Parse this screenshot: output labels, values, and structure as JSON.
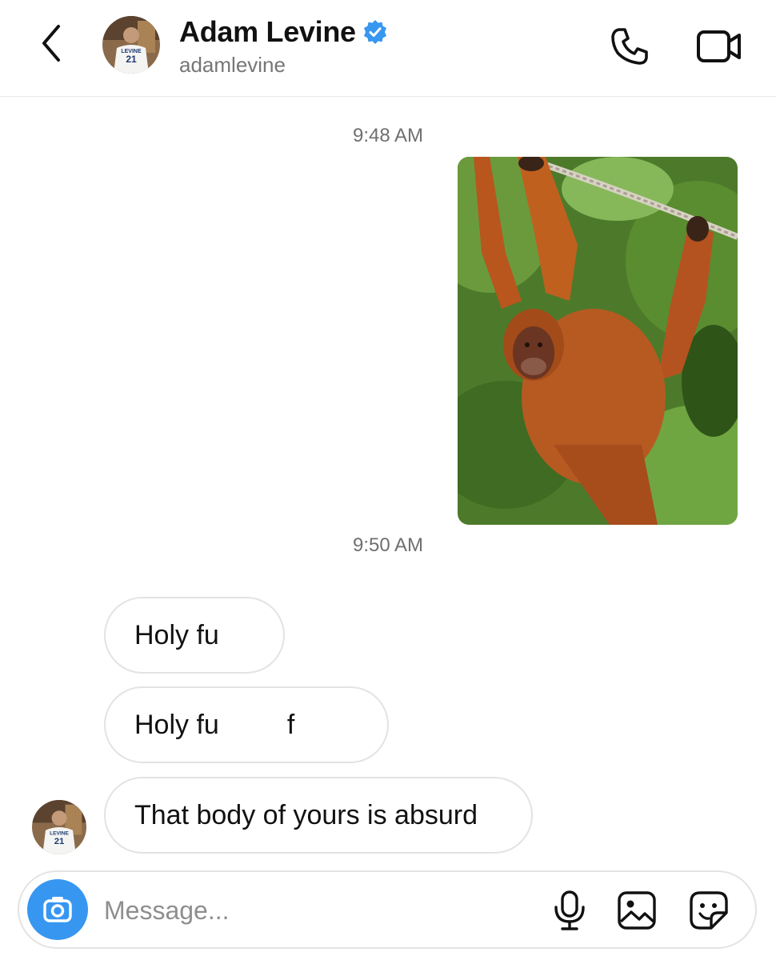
{
  "header": {
    "name": "Adam Levine",
    "username": "adamlevine",
    "verified": true
  },
  "avatar_jersey": {
    "name": "LEVINE",
    "number": "21"
  },
  "conversation": {
    "timestamps": [
      "9:48 AM",
      "9:50 AM"
    ],
    "sent_photo": {
      "description_icon": "orangutan-photo"
    },
    "received_messages": [
      "Holy fu",
      "Holy fu         f",
      "That body of yours is absurd"
    ]
  },
  "composer": {
    "placeholder": "Message...",
    "value": ""
  },
  "icons": {
    "back": "chevron-left-icon",
    "call": "phone-icon",
    "video": "video-camera-icon",
    "camera": "camera-icon",
    "mic": "microphone-icon",
    "gallery": "image-icon",
    "sticker": "sticker-icon",
    "verified": "verified-badge-icon"
  },
  "colors": {
    "accent": "#3797f0",
    "verified": "#3897f0",
    "bubble_border": "#e3e3e3",
    "timestamp": "#6f6f6f"
  }
}
